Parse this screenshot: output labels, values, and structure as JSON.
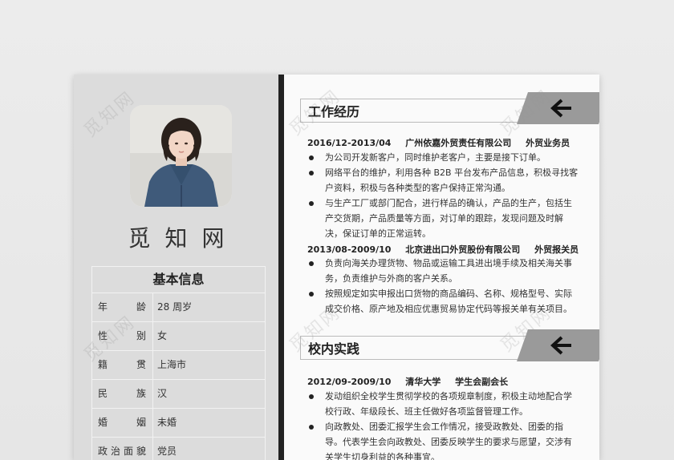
{
  "watermark": "觅知网",
  "profile": {
    "name": "觅知网",
    "info_title": "基本信息",
    "rows": [
      {
        "key": "年龄",
        "value": "28 周岁"
      },
      {
        "key": "性别",
        "value": "女"
      },
      {
        "key": "籍贯",
        "value": "上海市"
      },
      {
        "key": "民族",
        "value": "汉"
      },
      {
        "key": "婚姻",
        "value": "未婚"
      },
      {
        "key": "政治面貌",
        "value": "党员"
      }
    ]
  },
  "sections": [
    {
      "title": "工作经历",
      "icon": "arrow-left-icon",
      "entries": [
        {
          "date": "2016/12-2013/04",
          "org": "广州依嘉外贸责任有限公司",
          "role": "外贸业务员",
          "bullets": [
            "为公司开发新客户，同时维护老客户，主要是接下订单。",
            "网络平台的维护，利用各种 B2B 平台发布产品信息，积极寻找客户资料，积极与各种类型的客户保持正常沟通。",
            "与生产工厂或部门配合，进行样品的确认，产品的生产，包括生产交货期，产品质量等方面，对订单的跟踪，发现问题及时解决，保证订单的正常运转。"
          ]
        },
        {
          "date": "2013/08-2009/10",
          "org": "北京进出口外贸股份有限公司",
          "role": "外贸报关员",
          "bullets": [
            "负责向海关办理货物、物品或运输工具进出境手续及相关海关事务，负责维护与外商的客户关系。",
            "按照规定如实申报出口货物的商品编码、名称、规格型号、实际成交价格、原产地及相应优惠贸易协定代码等报关单有关项目。"
          ]
        }
      ]
    },
    {
      "title": "校内实践",
      "icon": "arrow-left-icon",
      "entries": [
        {
          "date": "2012/09-2009/10",
          "org": "清华大学",
          "role": "学生会副会长",
          "bullets": [
            "发动组织全校学生贯彻学校的各项规章制度，积极主动地配合学校行政、年级段长、班主任做好各项监督管理工作。",
            "向政教处、团委汇报学生会工作情况，接受政教处、团委的指导。代表学生会向政教处、团委反映学生的要求与愿望，交涉有关学生切身利益的各种事宜。"
          ]
        }
      ]
    }
  ],
  "colors": {
    "accent": "#222222",
    "tab": "#9a9a9a",
    "panel": "#dcdcdc"
  }
}
